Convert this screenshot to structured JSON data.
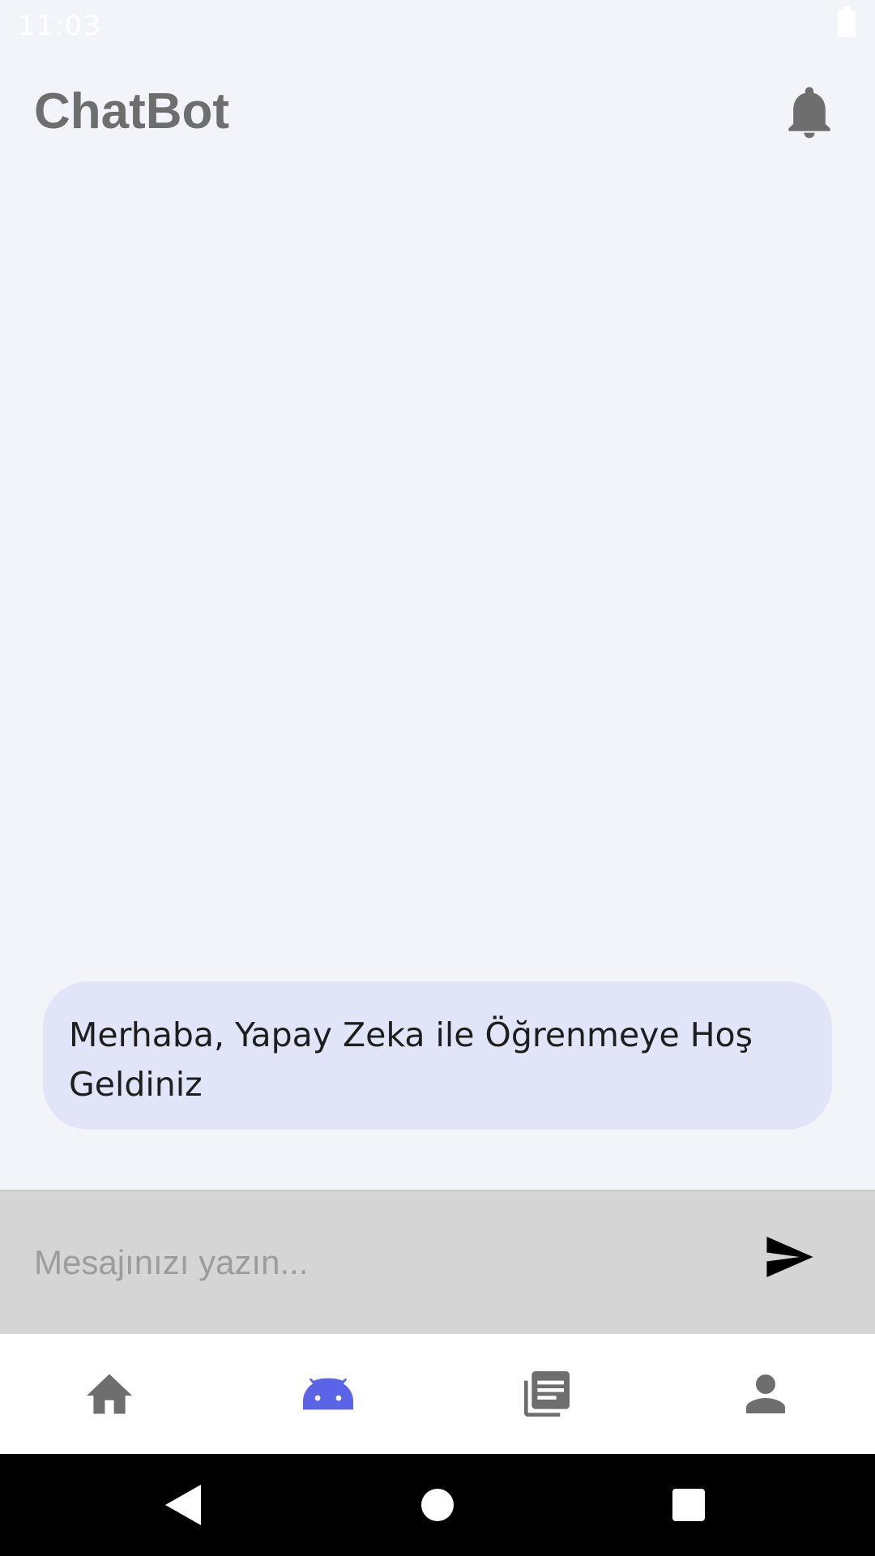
{
  "status_bar": {
    "time": "11:03",
    "icons": [
      "battery-icon"
    ]
  },
  "header": {
    "title": "ChatBot",
    "notification_icon": "bell-icon"
  },
  "chat": {
    "messages": [
      {
        "sender": "bot",
        "text": "Merhaba, Yapay Zeka ile Öğrenmeye Hoş Geldiniz"
      }
    ]
  },
  "composer": {
    "placeholder": "Mesajınızı yazın...",
    "value": "",
    "send_icon": "send-icon"
  },
  "bottom_nav": {
    "items": [
      {
        "icon": "home-icon",
        "active": false
      },
      {
        "icon": "android-icon",
        "active": true
      },
      {
        "icon": "library-books-icon",
        "active": false
      },
      {
        "icon": "person-icon",
        "active": false
      }
    ]
  },
  "system_nav": {
    "icons": [
      "back-icon",
      "home-circle-icon",
      "recents-icon"
    ]
  },
  "colors": {
    "background": "#f3f4f9",
    "bubble": "#e2e5f8",
    "composer": "#d5d5d5",
    "accent_active": "#5b63e6",
    "icon_inactive": "#6e6e6e",
    "title_text": "#6e6e6e"
  }
}
